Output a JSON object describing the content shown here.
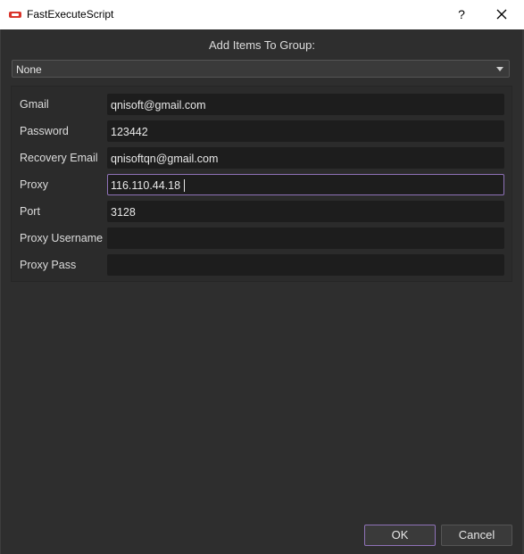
{
  "window": {
    "title": "FastExecuteScript",
    "help_label": "?",
    "close_label": "✕"
  },
  "group": {
    "heading": "Add Items To Group:",
    "selected": "None"
  },
  "form": {
    "rows": [
      {
        "label": "Gmail",
        "value": "qnisoft@gmail.com"
      },
      {
        "label": "Password",
        "value": "123442"
      },
      {
        "label": "Recovery Email",
        "value": "qnisoftqn@gmail.com"
      },
      {
        "label": "Proxy",
        "value": "116.110.44.18"
      },
      {
        "label": "Port",
        "value": "3128"
      },
      {
        "label": "Proxy Username",
        "value": ""
      },
      {
        "label": "Proxy Pass",
        "value": ""
      }
    ]
  },
  "buttons": {
    "ok": "OK",
    "cancel": "Cancel"
  },
  "colors": {
    "background": "#2e2e2e",
    "field": "#1d1d1d",
    "focus_accent": "#8f72b8"
  },
  "icons": {
    "app": "app-logo-icon",
    "combo": "chevron-down-icon"
  }
}
